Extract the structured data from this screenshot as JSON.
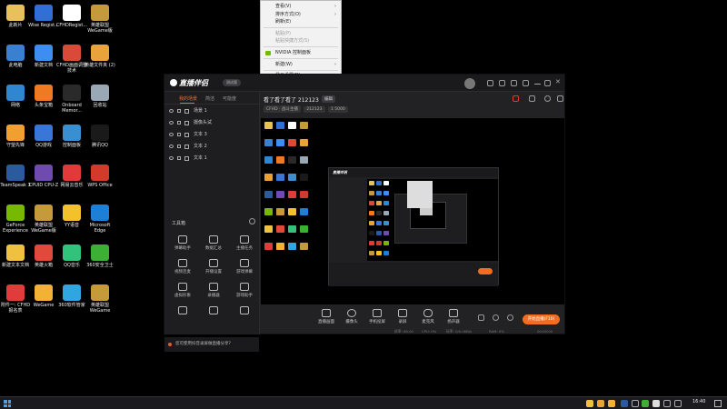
{
  "desktop": {
    "icons": [
      {
        "label": "此新片",
        "color": "#e8c15a"
      },
      {
        "label": "Wise Regist...",
        "color": "#2f6fd6"
      },
      {
        "label": "CFHDRegist...",
        "color": "#ffffff"
      },
      {
        "label": "英雄联盟 WeGame版",
        "color": "#c49a3a"
      },
      {
        "label": "此电脑",
        "color": "#3b7fd0"
      },
      {
        "label": "新建文档",
        "color": "#3d8ef0"
      },
      {
        "label": "CFHD画面调整技术",
        "color": "#d94a38"
      },
      {
        "label": "英雄文件夹 (2)",
        "color": "#e8a33a"
      },
      {
        "label": "网络",
        "color": "#2f86d1"
      },
      {
        "label": "头条宝箱",
        "color": "#f07a22"
      },
      {
        "label": "Onboard Memor...",
        "color": "#2a2a2a"
      },
      {
        "label": "回收站",
        "color": "#9aa7b5"
      },
      {
        "label": "守望先锋",
        "color": "#f0a030"
      },
      {
        "label": "QQ游戏",
        "color": "#3a76d8"
      },
      {
        "label": "控制面板",
        "color": "#3a8fd0"
      },
      {
        "label": "腾讯QQ",
        "color": "#1a1a1a"
      },
      {
        "label": "TeamSpeak 3",
        "color": "#2b5a9e"
      },
      {
        "label": "CPUID CPU-Z",
        "color": "#6f4ab0"
      },
      {
        "label": "网易云音乐",
        "color": "#e03a3a"
      },
      {
        "label": "WPS Office",
        "color": "#d23a2a"
      },
      {
        "label": "GeForce Experience",
        "color": "#76b900"
      },
      {
        "label": "英雄联盟 WeGame版",
        "color": "#c49a3a"
      },
      {
        "label": "YY语音",
        "color": "#f3c12a"
      },
      {
        "label": "Microsoft Edge",
        "color": "#1e7fd6"
      },
      {
        "label": "新建文本文档",
        "color": "#f0c040"
      },
      {
        "label": "英雄火箱",
        "color": "#e04a3a"
      },
      {
        "label": "QQ音乐",
        "color": "#31c27c"
      },
      {
        "label": "360安全卫士",
        "color": "#3cb034"
      },
      {
        "label": "附件一: CFHD报名表",
        "color": "#e23b3b"
      },
      {
        "label": "WeGame",
        "color": "#f2b233"
      },
      {
        "label": "360软件管家",
        "color": "#2fa6e0"
      },
      {
        "label": "英雄联盟 WeGame",
        "color": "#c49a3a"
      }
    ]
  },
  "context_menu": {
    "items": [
      {
        "label": "查看(V)",
        "disabled": false,
        "submenu": true
      },
      {
        "label": "排序方式(O)",
        "disabled": false,
        "submenu": true
      },
      {
        "label": "刷新(E)",
        "disabled": false,
        "submenu": false
      },
      {
        "sep": true
      },
      {
        "label": "粘贴(P)",
        "disabled": true,
        "submenu": false
      },
      {
        "label": "粘贴快捷方式(S)",
        "disabled": true,
        "submenu": false
      },
      {
        "sep": true
      },
      {
        "label": "NVIDIA 控制面板",
        "disabled": false,
        "submenu": false,
        "icon": "#76b900"
      },
      {
        "sep": true
      },
      {
        "label": "新建(W)",
        "disabled": false,
        "submenu": true
      },
      {
        "sep": true
      },
      {
        "label": "显示设置(D)",
        "disabled": false,
        "submenu": false,
        "icon": "#3a7fd0"
      },
      {
        "label": "个性化(R)",
        "disabled": false,
        "submenu": false,
        "icon": "#3a9fd0"
      }
    ]
  },
  "app": {
    "logo_text": "直播伴侣",
    "version_badge": "测试版",
    "left_tabs": [
      "我的场景",
      "简洁",
      "可能度"
    ],
    "scenes": [
      "场景 1",
      "摄像头试",
      "文本 3",
      "文本 2",
      "文本 1"
    ],
    "toolbox_title": "工具箱",
    "tools": [
      [
        "弹幕助手",
        "数据汇总",
        "主播任务"
      ],
      [
        "视频连麦",
        "开播设置",
        "游戏弹幕"
      ],
      [
        "虚拟形象",
        "录播器",
        "游戏助手"
      ],
      [
        "",
        "",
        ""
      ]
    ],
    "notice": "您可使用抖音录屏做直播分享?",
    "room_title": "看了看了看了 212123",
    "edit_label": "编辑",
    "tags": [
      "CFHD · 战斗主播",
      "212123",
      "1 5000"
    ],
    "controls": [
      "直播画面",
      "摄像头",
      "手机投屏",
      "录屏",
      "麦克风",
      "扬声器"
    ],
    "go_live_label": "开始直播(F10)",
    "stats": [
      "帧率: 60.00",
      "CPU: 0%",
      "码率: 0/0.0KB/s",
      "RAM: 0%",
      "00:00:00"
    ]
  },
  "preview_inner": {
    "title": "直播伴侣"
  },
  "taskbar": {
    "clock": "16:40"
  }
}
